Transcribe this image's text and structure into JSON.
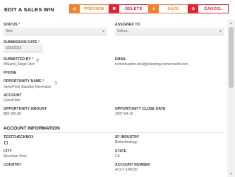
{
  "page": {
    "title": "EDIT A SALES WIN"
  },
  "toolbar": {
    "preview_label": "PREVIEW",
    "delete_label": "DELETE",
    "save_label": "SAVE",
    "cancel_label": "CANCEL",
    "preview_icon": "⇄",
    "delete_icon": "✖",
    "save_icon": "⤓",
    "cancel_icon": "⊘"
  },
  "colors": {
    "accent": "#f47f2a",
    "danger": "#e8212e"
  },
  "form": {
    "status": {
      "label": "STATUS",
      "required": "*",
      "value": "New"
    },
    "assigned_to": {
      "label": "ASSIGNED TO",
      "placeholder": "Select.."
    },
    "submission_date": {
      "label": "SUBMISSION DATE",
      "required": "*",
      "value": "3/20/2019"
    },
    "submitted_by": {
      "label": "SUBMITTED BY",
      "required": "*",
      "value": "INSand_Stage User"
    },
    "email": {
      "label": "EMAIL",
      "value": "rozinnovation.dev@psteering.onmicrosoft.com"
    },
    "phone": {
      "label": "PHONE"
    },
    "opportunity_name": {
      "label": "OPPORTUNITY NAME",
      "required": "*",
      "value": "GenePoint Standby Generator"
    },
    "account": {
      "label": "ACCOUNT",
      "value": "GenePoint"
    },
    "opportunity_amount": {
      "label": "OPPORTUNITY AMOUNT",
      "value": "$85,000.00"
    },
    "opportunity_close_date": {
      "label": "OPPORTUNITY CLOSE DATE",
      "value": "2007-04-16"
    }
  },
  "account_info": {
    "heading": "ACCOUNT INFORMATION",
    "testcheckbox": {
      "label": "TESTCHECKBOX",
      "checked": false
    },
    "sf_industry": {
      "label": "SF INDUSTRY",
      "value": "Biotechnology"
    },
    "city": {
      "label": "CITY",
      "value": "Mountain View"
    },
    "state": {
      "label": "STATE",
      "value": "CA"
    },
    "country": {
      "label": "COUNTRY"
    },
    "account_number": {
      "label": "ACCOUNT NUMBER",
      "value": "ACCT-100035"
    }
  }
}
